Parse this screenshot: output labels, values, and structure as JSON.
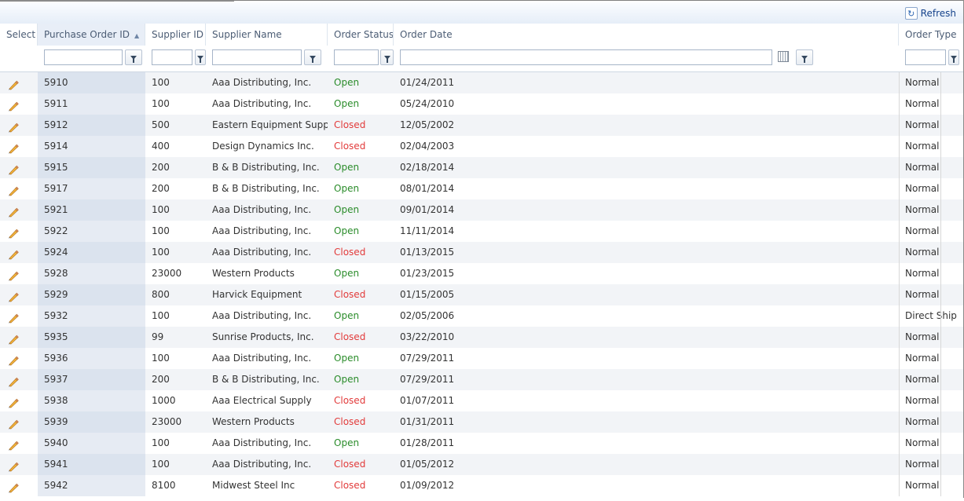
{
  "toolbar": {
    "refresh_label": "Refresh",
    "refresh_icon": "refresh-icon"
  },
  "columns": {
    "select": "Select",
    "po_id": "Purchase Order ID",
    "supplier_id": "Supplier ID",
    "supplier_name": "Supplier Name",
    "order_status": "Order Status",
    "order_date": "Order Date",
    "order_type": "Order Type"
  },
  "sort": {
    "column": "po_id",
    "direction": "ascending"
  },
  "colors": {
    "open": "#2a8c2a",
    "closed": "#e23b3b"
  },
  "rows": [
    {
      "po": "5910",
      "sid": "100",
      "name": "Aaa Distributing, Inc.",
      "status": "Open",
      "date": "01/24/2011",
      "type": "Normal"
    },
    {
      "po": "5911",
      "sid": "100",
      "name": "Aaa Distributing, Inc.",
      "status": "Open",
      "date": "05/24/2010",
      "type": "Normal"
    },
    {
      "po": "5912",
      "sid": "500",
      "name": "Eastern Equipment Supply",
      "status": "Closed",
      "date": "12/05/2002",
      "type": "Normal"
    },
    {
      "po": "5914",
      "sid": "400",
      "name": "Design Dynamics Inc.",
      "status": "Closed",
      "date": "02/04/2003",
      "type": "Normal"
    },
    {
      "po": "5915",
      "sid": "200",
      "name": "B & B Distributing, Inc.",
      "status": "Open",
      "date": "02/18/2014",
      "type": "Normal"
    },
    {
      "po": "5917",
      "sid": "200",
      "name": "B & B Distributing, Inc.",
      "status": "Open",
      "date": "08/01/2014",
      "type": "Normal"
    },
    {
      "po": "5921",
      "sid": "100",
      "name": "Aaa Distributing, Inc.",
      "status": "Open",
      "date": "09/01/2014",
      "type": "Normal"
    },
    {
      "po": "5922",
      "sid": "100",
      "name": "Aaa Distributing, Inc.",
      "status": "Open",
      "date": "11/11/2014",
      "type": "Normal"
    },
    {
      "po": "5924",
      "sid": "100",
      "name": "Aaa Distributing, Inc.",
      "status": "Closed",
      "date": "01/13/2015",
      "type": "Normal"
    },
    {
      "po": "5928",
      "sid": "23000",
      "name": "Western Products",
      "status": "Open",
      "date": "01/23/2015",
      "type": "Normal"
    },
    {
      "po": "5929",
      "sid": "800",
      "name": "Harvick Equipment",
      "status": "Closed",
      "date": "01/15/2005",
      "type": "Normal"
    },
    {
      "po": "5932",
      "sid": "100",
      "name": "Aaa Distributing, Inc.",
      "status": "Open",
      "date": "02/05/2006",
      "type": "Direct Ship"
    },
    {
      "po": "5935",
      "sid": "99",
      "name": "Sunrise Products, Inc.",
      "status": "Closed",
      "date": "03/22/2010",
      "type": "Normal"
    },
    {
      "po": "5936",
      "sid": "100",
      "name": "Aaa Distributing, Inc.",
      "status": "Open",
      "date": "07/29/2011",
      "type": "Normal"
    },
    {
      "po": "5937",
      "sid": "200",
      "name": "B & B Distributing, Inc.",
      "status": "Open",
      "date": "07/29/2011",
      "type": "Normal"
    },
    {
      "po": "5938",
      "sid": "1000",
      "name": "Aaa Electrical Supply",
      "status": "Closed",
      "date": "01/07/2011",
      "type": "Normal"
    },
    {
      "po": "5939",
      "sid": "23000",
      "name": "Western Products",
      "status": "Closed",
      "date": "01/31/2011",
      "type": "Normal"
    },
    {
      "po": "5940",
      "sid": "100",
      "name": "Aaa Distributing, Inc.",
      "status": "Open",
      "date": "01/28/2011",
      "type": "Normal"
    },
    {
      "po": "5941",
      "sid": "100",
      "name": "Aaa Distributing, Inc.",
      "status": "Closed",
      "date": "01/05/2012",
      "type": "Normal"
    },
    {
      "po": "5942",
      "sid": "8100",
      "name": "Midwest Steel Inc",
      "status": "Closed",
      "date": "01/09/2012",
      "type": "Normal"
    }
  ]
}
